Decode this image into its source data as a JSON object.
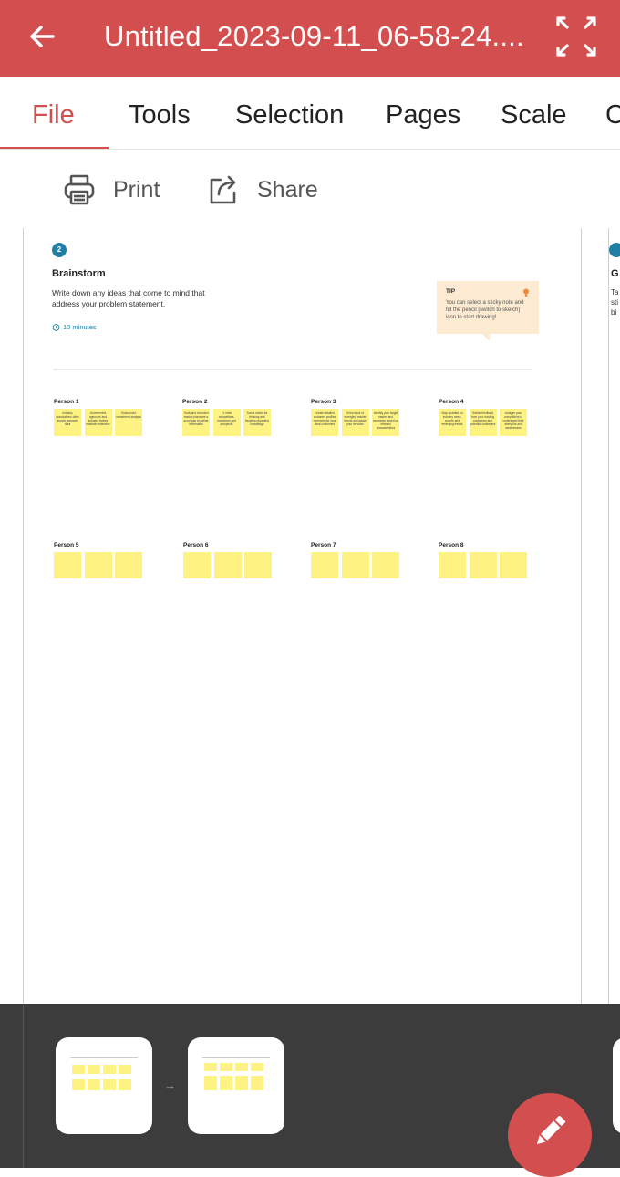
{
  "header": {
    "title": "Untitled_2023-09-11_06-58-24...."
  },
  "tabs": [
    {
      "label": "File",
      "active": true
    },
    {
      "label": "Tools"
    },
    {
      "label": "Selection"
    },
    {
      "label": "Pages"
    },
    {
      "label": "Scale"
    },
    {
      "label": "C"
    }
  ],
  "toolbar": {
    "print_label": "Print",
    "share_label": "Share"
  },
  "document": {
    "step_number": "2",
    "title": "Brainstorm",
    "description": "Write down any ideas that come to mind that address your problem statement.",
    "timer": "10 minutes",
    "tip": {
      "label": "TIP",
      "text": "You can select a sticky note and hit the pencil [switch to sketch] icon to start drawing!"
    },
    "persons": [
      {
        "name": "Person 1",
        "notes": [
          "Industry associations often supply research data",
          "Government agencies and industry bodies maintain extensive",
          "Outsourced investment analysis"
        ]
      },
      {
        "name": "Person 2",
        "notes": [
          "Tools and recorded market plans are a good way to gather information",
          "To meet competitors, customers and prospects",
          "Social media for thinking and trending regarding knowledge"
        ]
      },
      {
        "name": "Person 3",
        "notes": [
          "Create detailed customer profiles representing your ideal customers",
          "Keep track of emerging market trends and adapt your services",
          "Identify your target market and segments based on relevant characteristics"
        ]
      },
      {
        "name": "Person 4",
        "notes": [
          "Stay updated on industry news, reports and emerging trends",
          "Gather feedback from your existing customers and potential customers",
          "Analyze your competitors to understand their strengths and weaknesses"
        ]
      },
      {
        "name": "Person 5",
        "notes": [
          "",
          "",
          ""
        ]
      },
      {
        "name": "Person 6",
        "notes": [
          "",
          "",
          ""
        ]
      },
      {
        "name": "Person 7",
        "notes": [
          "",
          "",
          ""
        ]
      },
      {
        "name": "Person 8",
        "notes": [
          "",
          "",
          ""
        ]
      }
    ],
    "next_page": {
      "title": "G",
      "desc": "Ta\nsti\nbi"
    }
  },
  "tray": {
    "arrow": "→"
  },
  "colors": {
    "brand": "#d34e4e",
    "sticky": "#fdf282",
    "accent_blue": "#1f7fa6",
    "tip_bg": "#fcebd2"
  },
  "icons": [
    "back-arrow-icon",
    "fullscreen-icon",
    "printer-icon",
    "share-icon",
    "timer-icon",
    "lightbulb-icon",
    "pencil-icon"
  ]
}
